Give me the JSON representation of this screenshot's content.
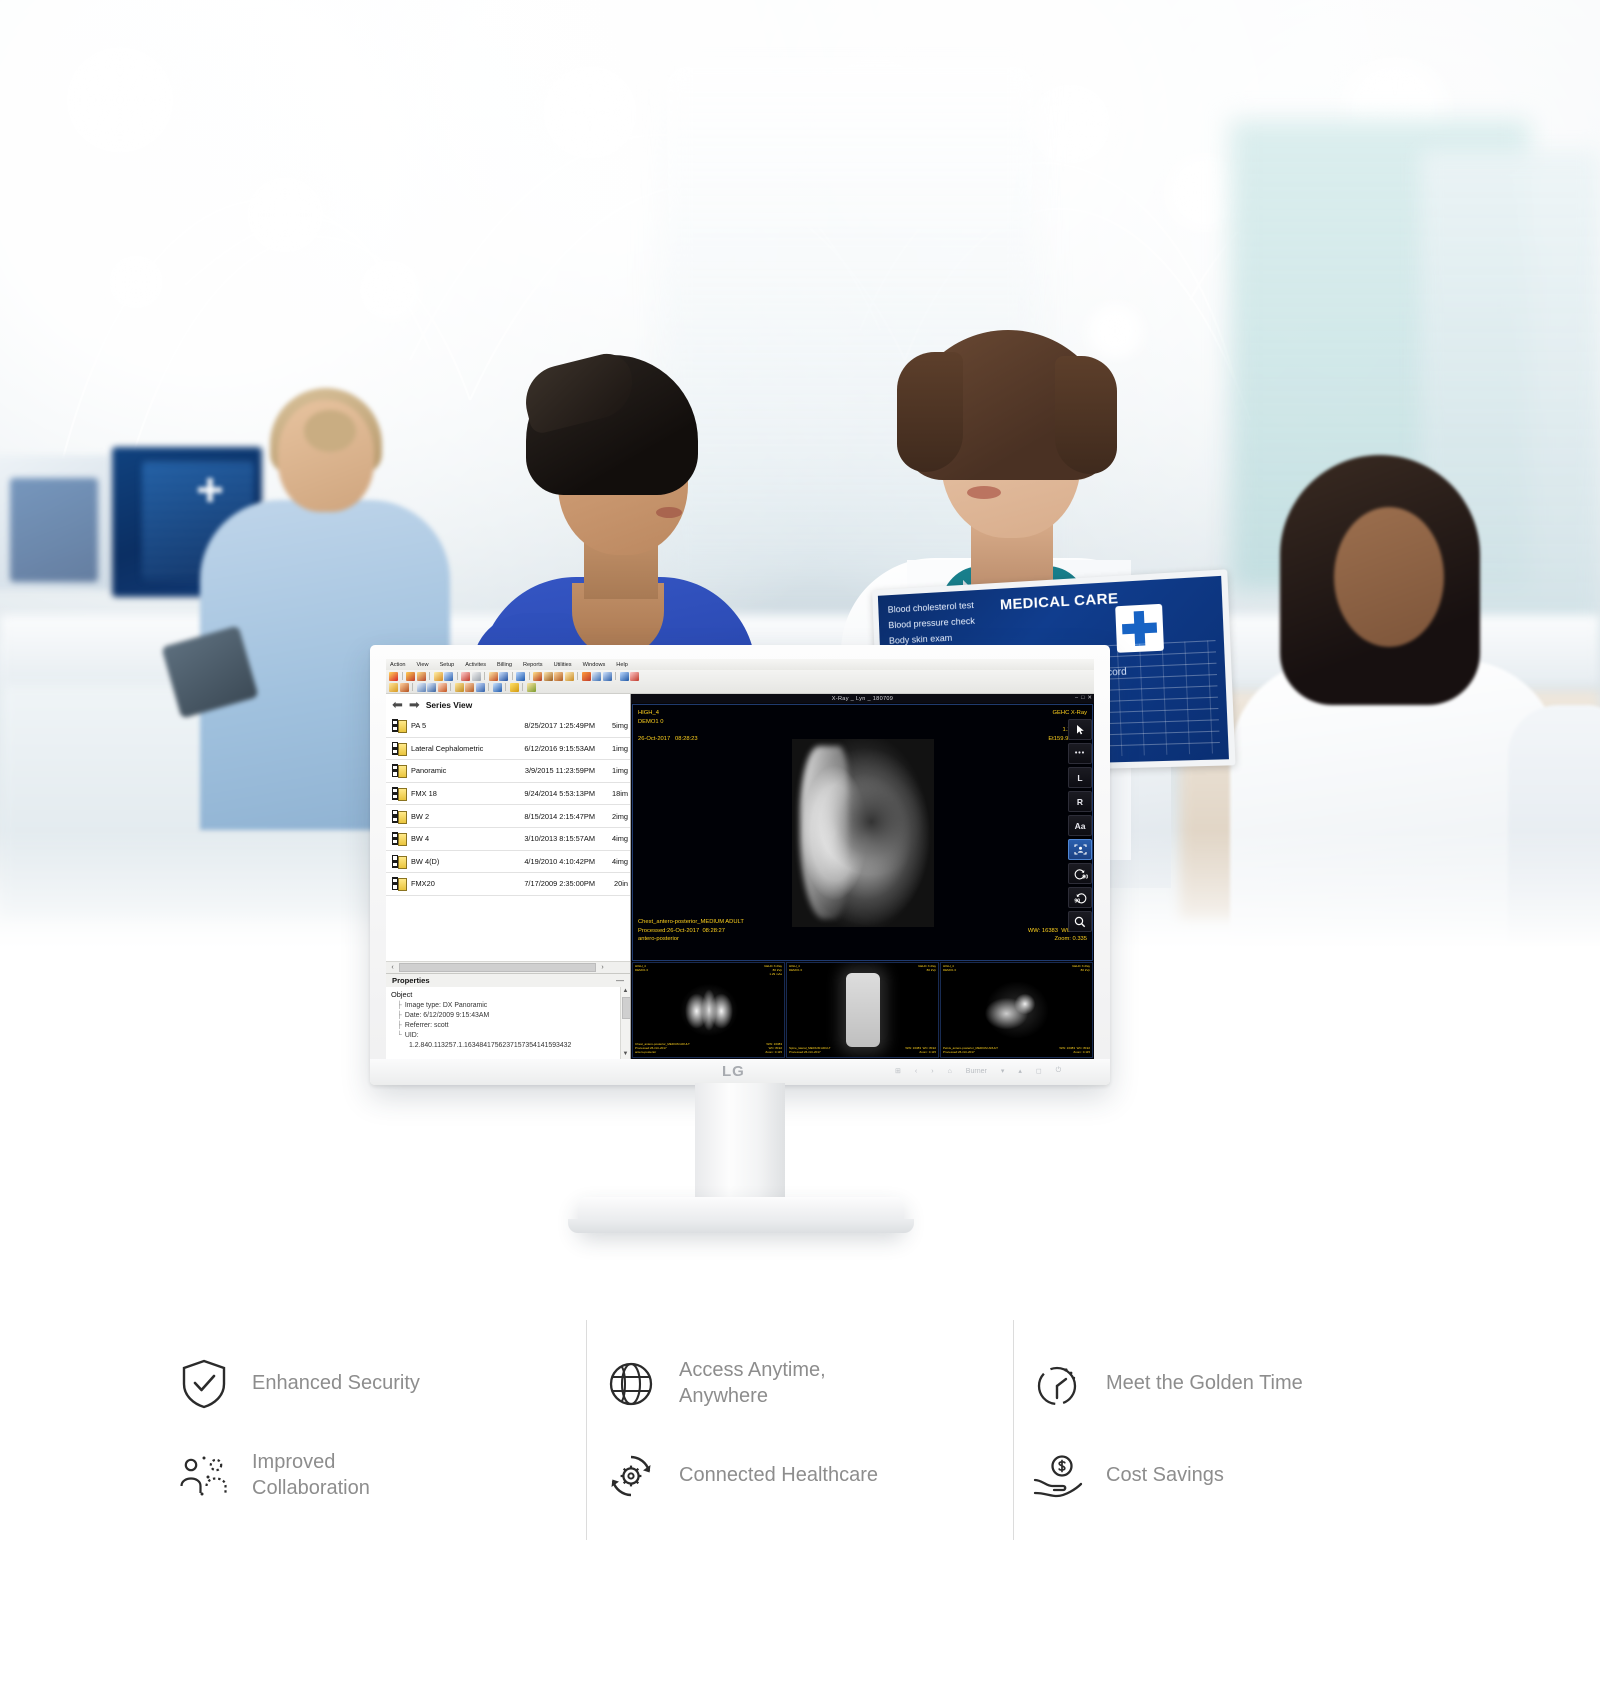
{
  "app": {
    "window_title": "X-Ray _ Lyn _ 180709",
    "menubar": [
      "Action",
      "View",
      "Setup",
      "Activites",
      "Billing",
      "Reports",
      "Utilities",
      "Windows",
      "Help"
    ],
    "window_buttons": [
      "–",
      "□",
      "✕"
    ]
  },
  "series_panel": {
    "title": "Series View",
    "back_arrow": "⬅",
    "forward_arrow": "➡",
    "rows": [
      {
        "name": "PA 5",
        "date": "8/25/2017 1:25:49PM",
        "count": "5img"
      },
      {
        "name": "Lateral Cephalometric",
        "date": "6/12/2016 9:15:53AM",
        "count": "1img"
      },
      {
        "name": "Panoramic",
        "date": "3/9/2015 11:23:59PM",
        "count": "1img"
      },
      {
        "name": "FMX 18",
        "date": "9/24/2014 5:53:13PM",
        "count": "18im"
      },
      {
        "name": "BW 2",
        "date": "8/15/2014 2:15:47PM",
        "count": "2img"
      },
      {
        "name": "BW 4",
        "date": "3/10/2013 8:15:57AM",
        "count": "4img"
      },
      {
        "name": "BW 4(D)",
        "date": "4/19/2010 4:10:42PM",
        "count": "4img"
      },
      {
        "name": "FMX20",
        "date": "7/17/2009 2:35:00PM",
        "count": "20in"
      }
    ],
    "hscroll_left": "‹",
    "hscroll_right": "›"
  },
  "properties": {
    "title": "Properties",
    "collapse": "—",
    "object_label": "Object",
    "fields": [
      {
        "label": "Image type:",
        "value": "DX Panoramic"
      },
      {
        "label": "Date:",
        "value": "6/12/2009  9:15:43AM"
      },
      {
        "label": "Referrer:",
        "value": "scott"
      },
      {
        "label": "UID:",
        "value": ""
      }
    ],
    "uid_value": "1.2.840.113257.1.1634841756237157354141593432",
    "scroll_up": "▲",
    "scroll_down": "▼"
  },
  "viewer": {
    "overlay_top_left": "HIGH_4\nDEMO1 0\n\n26-Oct-2017   08:28:23",
    "overlay_top_right": "GEHC X-Ray\n80 kVp\n1.29 mAs\nEt159.99 Dt0.8",
    "overlay_bottom_left": "Chest_antero-posterior_MEDIUM ADULT\nProcessed:26-Oct-2017  08:28:27\nantero-posterior",
    "overlay_bottom_right": "WW: 16383  WC: 8192\nZoom: 0.335",
    "tools": [
      {
        "name": "pointer-tool",
        "glyph": "➤"
      },
      {
        "name": "more-tool",
        "glyph": "•••"
      },
      {
        "name": "left-marker",
        "glyph": "L"
      },
      {
        "name": "right-marker",
        "glyph": "R"
      },
      {
        "name": "text-tool",
        "glyph": "Aa"
      },
      {
        "name": "crop-tool",
        "glyph": "⛶"
      },
      {
        "name": "rotate-ccw-90",
        "glyph": "90"
      },
      {
        "name": "rotate-cw-90",
        "glyph": "90"
      },
      {
        "name": "zoom-tool",
        "glyph": "🔍"
      }
    ]
  },
  "thumbnails": [
    {
      "type": "chest",
      "top_left": "HIGH_4\nDEMO1 0",
      "top_right": "GEHC X-Ray\n80 kVp\n1.29 mAs",
      "bottom_left": "Chest_antero-posterior_MEDIUM ADULT\nProcessed:26-Oct-2017\nantero-posterior",
      "bottom_right": "WW: 16383\nWC: 8192\nZoom: 0.115"
    },
    {
      "type": "spine",
      "top_left": "HIGH_4\nDEMO1 0",
      "top_right": "GEHC X-Ray\n80 kVp",
      "bottom_left": "Spine_lateral_MEDIUM ADULT\nProcessed:26-Oct-2017",
      "bottom_right": "WW: 16383  WC: 8192\nZoom: 0.115"
    },
    {
      "type": "hip",
      "top_left": "HIGH_4\nDEMO1 0",
      "top_right": "GEHC X-Ray\n80 kVp",
      "bottom_left": "Pelvis_antero-posterior_MEDIUM ADULT\nProcessed:26-Oct-2017",
      "bottom_right": "WW: 16383  WC: 8192\nZoom: 0.115"
    }
  ],
  "monitor": {
    "brand": "LG",
    "osd": [
      "⊞",
      "‹",
      "›",
      "⌂",
      "Burner",
      "▾",
      "▴",
      "◻",
      "⏻"
    ]
  },
  "background_laptop": {
    "title": "MEDICAL CARE",
    "lines": [
      "Blood cholesterol test",
      "Blood pressure check",
      "Body skin exam"
    ],
    "record_label": "n record"
  },
  "features": {
    "columns": [
      {
        "items": [
          {
            "icon": "shield-check-icon",
            "label": "Enhanced Security"
          },
          {
            "icon": "collaboration-icon",
            "label": "Improved\nCollaboration"
          }
        ]
      },
      {
        "items": [
          {
            "icon": "globe-icon",
            "label": "Access Anytime,\nAnywhere"
          },
          {
            "icon": "connected-gear-icon",
            "label": "Connected Healthcare"
          }
        ]
      },
      {
        "items": [
          {
            "icon": "stopwatch-icon",
            "label": "Meet the Golden Time"
          },
          {
            "icon": "cost-savings-icon",
            "label": "Cost Savings"
          }
        ]
      }
    ]
  },
  "colors": {
    "accent_blue": "#2a5fae",
    "overlay_yellow": "#ffd21e",
    "scrubs_blue": "#2442a8",
    "feature_text": "#8d8d8d"
  }
}
